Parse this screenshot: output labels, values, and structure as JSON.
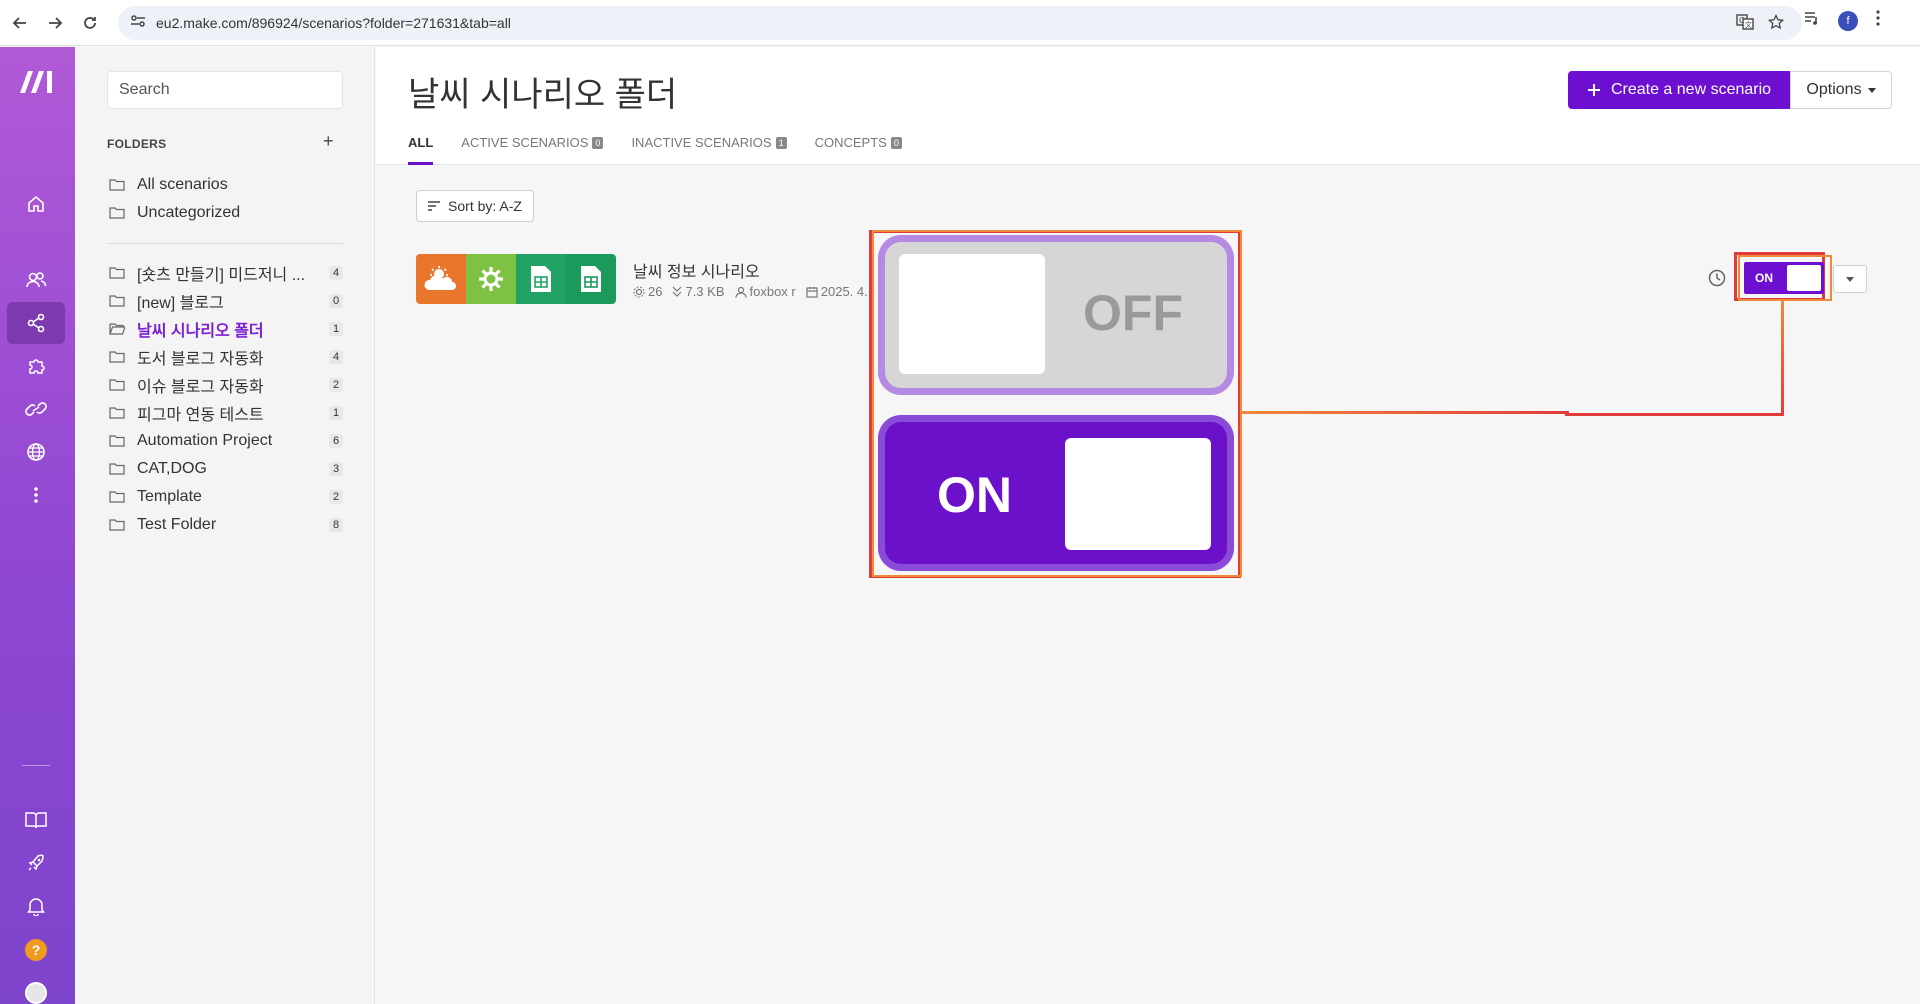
{
  "browser": {
    "url": "eu2.make.com/896924/scenarios?folder=271631&tab=all",
    "profile_initial": "f"
  },
  "rail": {
    "logo": "M",
    "icons": [
      "home-icon",
      "team-icon",
      "scenarios-icon",
      "apps-icon",
      "connections-icon",
      "globe-icon",
      "more-icon",
      "docs-icon",
      "rocket-icon",
      "bell-icon",
      "help-icon",
      "avatar-icon"
    ],
    "help_label": "?"
  },
  "sidebar": {
    "search_placeholder": "Search",
    "folders_header": "FOLDERS",
    "add_label": "+",
    "top_items": [
      {
        "label": "All scenarios"
      },
      {
        "label": "Uncategorized"
      }
    ],
    "items": [
      {
        "label": "[숏츠 만들기] 미드저니 ...",
        "count": "4"
      },
      {
        "label": "[new] 블로그",
        "count": "0"
      },
      {
        "label": "날씨 시나리오 폴더",
        "count": "1",
        "active": true
      },
      {
        "label": "도서 블로그 자동화",
        "count": "4"
      },
      {
        "label": "이슈 블로그 자동화",
        "count": "2"
      },
      {
        "label": "피그마 연동 테스트",
        "count": "1"
      },
      {
        "label": "Automation Project",
        "count": "6"
      },
      {
        "label": "CAT,DOG",
        "count": "3"
      },
      {
        "label": "Template",
        "count": "2"
      },
      {
        "label": "Test Folder",
        "count": "8"
      }
    ]
  },
  "header": {
    "title": "날씨 시나리오 폴더",
    "tabs": [
      {
        "label": "ALL",
        "badge": ""
      },
      {
        "label": "ACTIVE SCENARIOS",
        "badge": "0"
      },
      {
        "label": "INACTIVE SCENARIOS",
        "badge": "1"
      },
      {
        "label": "CONCEPTS",
        "badge": "0"
      }
    ],
    "create_label": "Create a new scenario",
    "options_label": "Options"
  },
  "content": {
    "sort_label": "Sort by: A-Z",
    "scenario": {
      "name": "날씨 정보 시나리오",
      "operations": "26",
      "data_size": "7.3 KB",
      "owner": "foxbox r",
      "date": "2025. 4.",
      "toggle_label": "ON",
      "modules": [
        {
          "icon": "weather-icon",
          "color": "#e8762b"
        },
        {
          "icon": "gear-icon",
          "color": "#7dc243"
        },
        {
          "icon": "sheets-icon",
          "color": "#21a366"
        },
        {
          "icon": "sheets-icon",
          "color": "#1a9b5c"
        }
      ]
    }
  },
  "callout": {
    "off_label": "OFF",
    "on_label": "ON"
  },
  "colors": {
    "brand": "#6d0fd1",
    "annotation_red": "#e13c3c",
    "annotation_orange": "#f0893a"
  }
}
